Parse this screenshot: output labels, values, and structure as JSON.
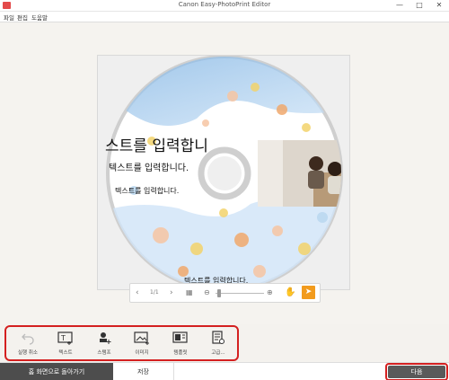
{
  "window": {
    "title": "Canon Easy-PhotoPrint Editor"
  },
  "menu": [
    "파일",
    "편집",
    "도움말"
  ],
  "disc": {
    "text_large": "스트를 입력합니",
    "text_medium": "텍스트를 입력합니다.",
    "text_small": "텍스트를 입력합니다.",
    "text_bottom": "텍스트를 입력합니다."
  },
  "zoombar": {
    "page_indicator": "1/1"
  },
  "tools": [
    {
      "label": "실행 취소",
      "icon": "undo-icon"
    },
    {
      "label": "텍스트",
      "icon": "text-box-icon"
    },
    {
      "label": "스탬프",
      "icon": "stamp-icon"
    },
    {
      "label": "이미지",
      "icon": "image-icon"
    },
    {
      "label": "템플릿",
      "icon": "template-icon"
    },
    {
      "label": "고급...",
      "icon": "advanced-icon"
    }
  ],
  "bottom": {
    "back_label": "홈 화면으로 돌아가기",
    "save_label": "저장",
    "next_label": "다음"
  },
  "colors": {
    "accent": "#f29b1d",
    "highlight_border": "#d42020",
    "dark_button": "#4d4d4d"
  }
}
